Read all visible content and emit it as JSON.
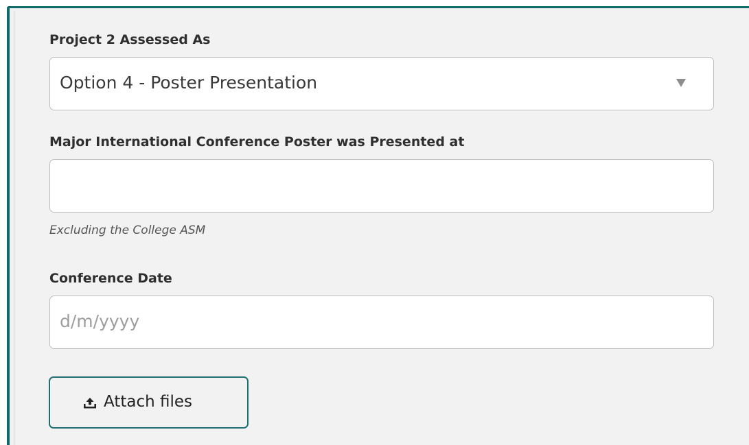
{
  "form": {
    "project_assessed": {
      "label": "Project 2 Assessed As",
      "selected_value": "Option 4 - Poster Presentation",
      "icon": "chevron-down-icon"
    },
    "conference": {
      "label": "Major International Conference Poster was Presented at",
      "value": "",
      "help_text": "Excluding the College ASM"
    },
    "conference_date": {
      "label": "Conference Date",
      "placeholder": "d/m/yyyy",
      "value": ""
    },
    "attach": {
      "label": "Attach files",
      "icon": "upload-icon"
    }
  },
  "colors": {
    "accent": "#0f6a6a",
    "button_border": "#1f6f73",
    "panel_background": "#f2f2f2",
    "field_border": "#bdbdbd"
  }
}
